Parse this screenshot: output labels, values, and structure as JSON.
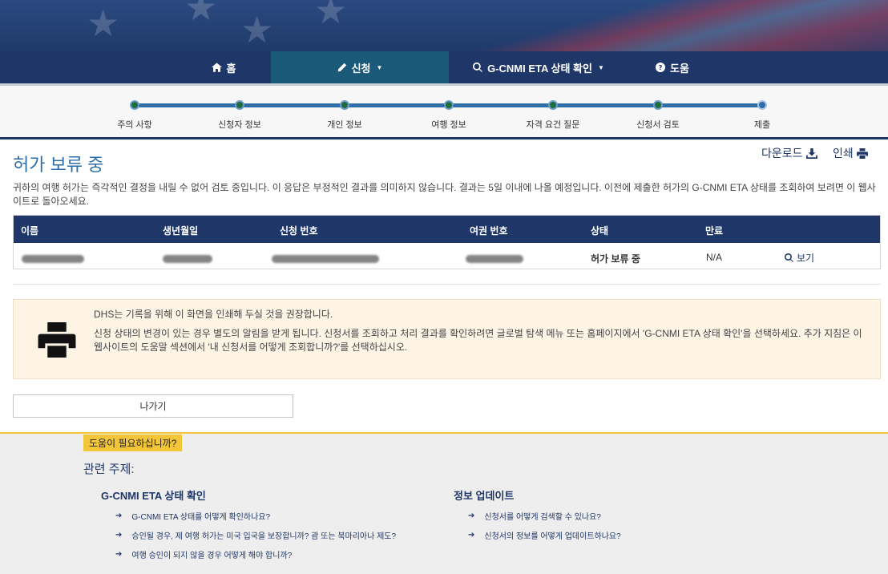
{
  "nav": {
    "items": [
      {
        "label": "홈",
        "icon": "home-icon"
      },
      {
        "label": "신청",
        "icon": "pencil-icon",
        "active": true
      },
      {
        "label": "G-CNMI ETA 상태 확인",
        "icon": "search-icon"
      },
      {
        "label": "도움",
        "icon": "question-circle-icon"
      }
    ]
  },
  "steps": [
    "주의 사항",
    "신청자 정보",
    "개인 정보",
    "여행 정보",
    "자격 요건 질문",
    "신청서 검토",
    "제출"
  ],
  "page": {
    "title": "허가 보류 중",
    "download_label": "다운로드",
    "print_label": "인쇄",
    "description": "귀하의 여행 허가는 즉각적인 결정을 내릴 수 없어 검토 중입니다. 이 응답은 부정적인 결과를 의미하지 않습니다. 결과는 5일 이내에 나올 예정입니다. 이전에 제출한 허가의 G-CNMI ETA 상태를 조회하여 보려면 이 웹사이트로 돌아오세요."
  },
  "table": {
    "headers": {
      "name": "이름",
      "dob": "생년월일",
      "app_no": "신청 번호",
      "passport": "여권 번호",
      "status": "상태",
      "expiry": "만료"
    },
    "row": {
      "status": "허가 보류 중",
      "expiry": "N/A",
      "view_label": "보기"
    }
  },
  "notice": {
    "line1": "DHS는 기록을 위해 이 화면을 인쇄해 두실 것을 권장합니다.",
    "line2": "신청 상태의 변경이 있는 경우 별도의 알림을 받게 됩니다. 신청서를 조회하고 처리 결과를 확인하려면 글로벌 탐색 메뉴 또는 홈페이지에서 'G-CNMI ETA 상태 확인'을 선택하세요. 추가 지침은 이 웹사이트의 도움말 섹션에서 '내 신청서를 어떻게 조회합니까?'를 선택하십시오."
  },
  "exit_label": "나가기",
  "help": {
    "badge": "도움이 필요하십니까?",
    "related_title": "관련 주제:",
    "col1": {
      "title": "G-CNMI ETA 상태 확인",
      "links": [
        "G-CNMI ETA 상태를 어떻게 확인하나요?",
        "승인될 경우, 제 여행 허가는 미국 입국을 보장합니까? 괌 또는 북마리아나 제도?",
        "여행 승인이 되지 않을 경우 어떻게 해야 합니까?"
      ]
    },
    "col2": {
      "title": "정보 업데이트",
      "links": [
        "신청서를 어떻게 검색할 수 있나요?",
        "신청서의 정보를 어떻게 업데이트하나요?"
      ]
    }
  }
}
